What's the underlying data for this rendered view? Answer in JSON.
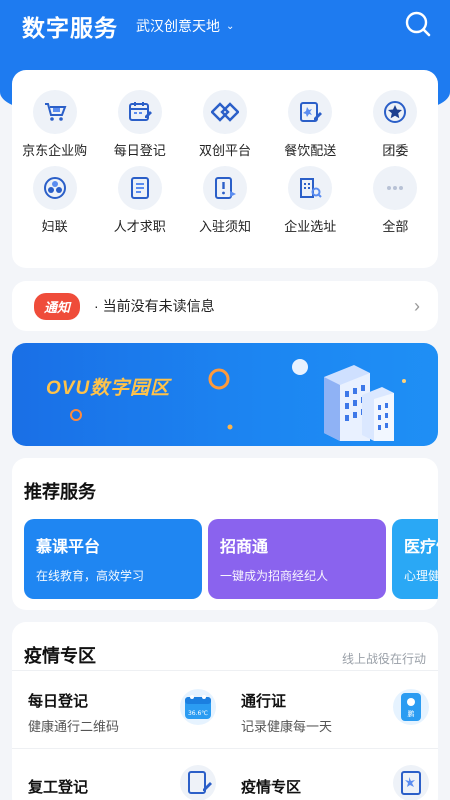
{
  "header": {
    "title": "数字服务",
    "location": "武汉创意天地"
  },
  "grid": [
    {
      "label": "京东企业购",
      "icon": "shopping-cart-icon"
    },
    {
      "label": "每日登记",
      "icon": "calendar-edit-icon"
    },
    {
      "label": "双创平台",
      "icon": "diamond-link-icon"
    },
    {
      "label": "餐饮配送",
      "icon": "food-delivery-icon"
    },
    {
      "label": "团委",
      "icon": "star-badge-icon"
    },
    {
      "label": "妇联",
      "icon": "women-federation-icon"
    },
    {
      "label": "人才求职",
      "icon": "resume-icon"
    },
    {
      "label": "入驻须知",
      "icon": "notice-doc-icon"
    },
    {
      "label": "企业选址",
      "icon": "building-search-icon"
    },
    {
      "label": "全部",
      "icon": "more-dots-icon"
    }
  ],
  "notice": {
    "badge": "通知",
    "text": "· 当前没有未读信息"
  },
  "banner": {
    "title": "OVU数字园区"
  },
  "recommend": {
    "title": "推荐服务",
    "items": [
      {
        "title": "慕课平台",
        "subtitle": "在线教育，高效学习",
        "color": "#1f86f2"
      },
      {
        "title": "招商通",
        "subtitle": "一键成为招商经纪人",
        "color": "#8a63ee"
      },
      {
        "title": "医疗健",
        "subtitle": "心理健",
        "color": "#2aa8f5"
      }
    ]
  },
  "epidemic": {
    "title": "疫情专区",
    "more": "线上战役在行动",
    "items": [
      {
        "title": "每日登记",
        "subtitle": "健康通行二维码",
        "icon": "calendar-icon",
        "icon_text": "36.6℃"
      },
      {
        "title": "通行证",
        "subtitle": "记录健康每一天",
        "icon": "pass-card-icon",
        "icon_text": "鹏"
      },
      {
        "title": "复工登记",
        "subtitle": "",
        "icon": "edit-form-icon"
      },
      {
        "title": "疫情专区",
        "subtitle": "",
        "icon": "medical-doc-icon"
      }
    ]
  },
  "colors": {
    "primary": "#1e7bf0",
    "badge": "#ef4c3a",
    "banner_title": "#ffc34a"
  }
}
